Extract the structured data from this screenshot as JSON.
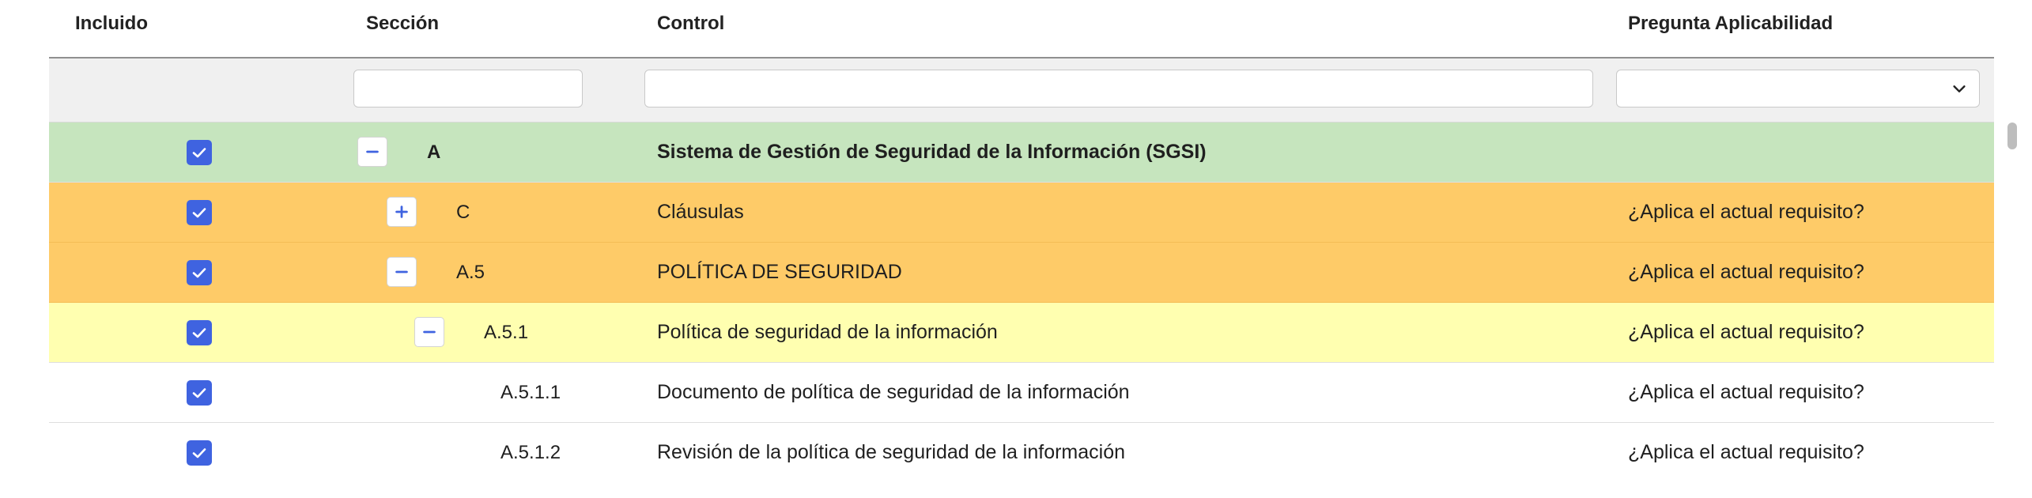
{
  "columns": {
    "incluido": "Incluido",
    "seccion": "Sección",
    "control": "Control",
    "pregunta": "Pregunta Aplicabilidad"
  },
  "filters": {
    "seccion_value": "",
    "control_value": "",
    "pregunta_value": ""
  },
  "icons": {
    "checkbox": "checkmark-icon",
    "expand": "plus-icon",
    "collapse": "minus-icon",
    "dropdown": "chevron-down-icon"
  },
  "colors": {
    "level1": "#c6e5be",
    "level2": "#fecb68",
    "level3": "#ffffb0",
    "checkbox": "#3f63e0"
  },
  "rows": [
    {
      "checked": true,
      "toggle": "collapse",
      "code": "A",
      "control": "Sistema de Gestión de Seguridad de la Información (SGSI)",
      "pregunta": ""
    },
    {
      "checked": true,
      "toggle": "expand",
      "code": "C",
      "control": "Cláusulas",
      "pregunta": "¿Aplica el actual requisito?"
    },
    {
      "checked": true,
      "toggle": "collapse",
      "code": "A.5",
      "control": "POLÍTICA DE SEGURIDAD",
      "pregunta": "¿Aplica el actual requisito?"
    },
    {
      "checked": true,
      "toggle": "collapse",
      "code": "A.5.1",
      "control": "Política de seguridad de la información",
      "pregunta": "¿Aplica el actual requisito?"
    },
    {
      "checked": true,
      "toggle": "",
      "code": "A.5.1.1",
      "control": "Documento de política de seguridad de la información",
      "pregunta": "¿Aplica el actual requisito?"
    },
    {
      "checked": true,
      "toggle": "",
      "code": "A.5.1.2",
      "control": "Revisión de la política de seguridad de la información",
      "pregunta": "¿Aplica el actual requisito?"
    }
  ]
}
